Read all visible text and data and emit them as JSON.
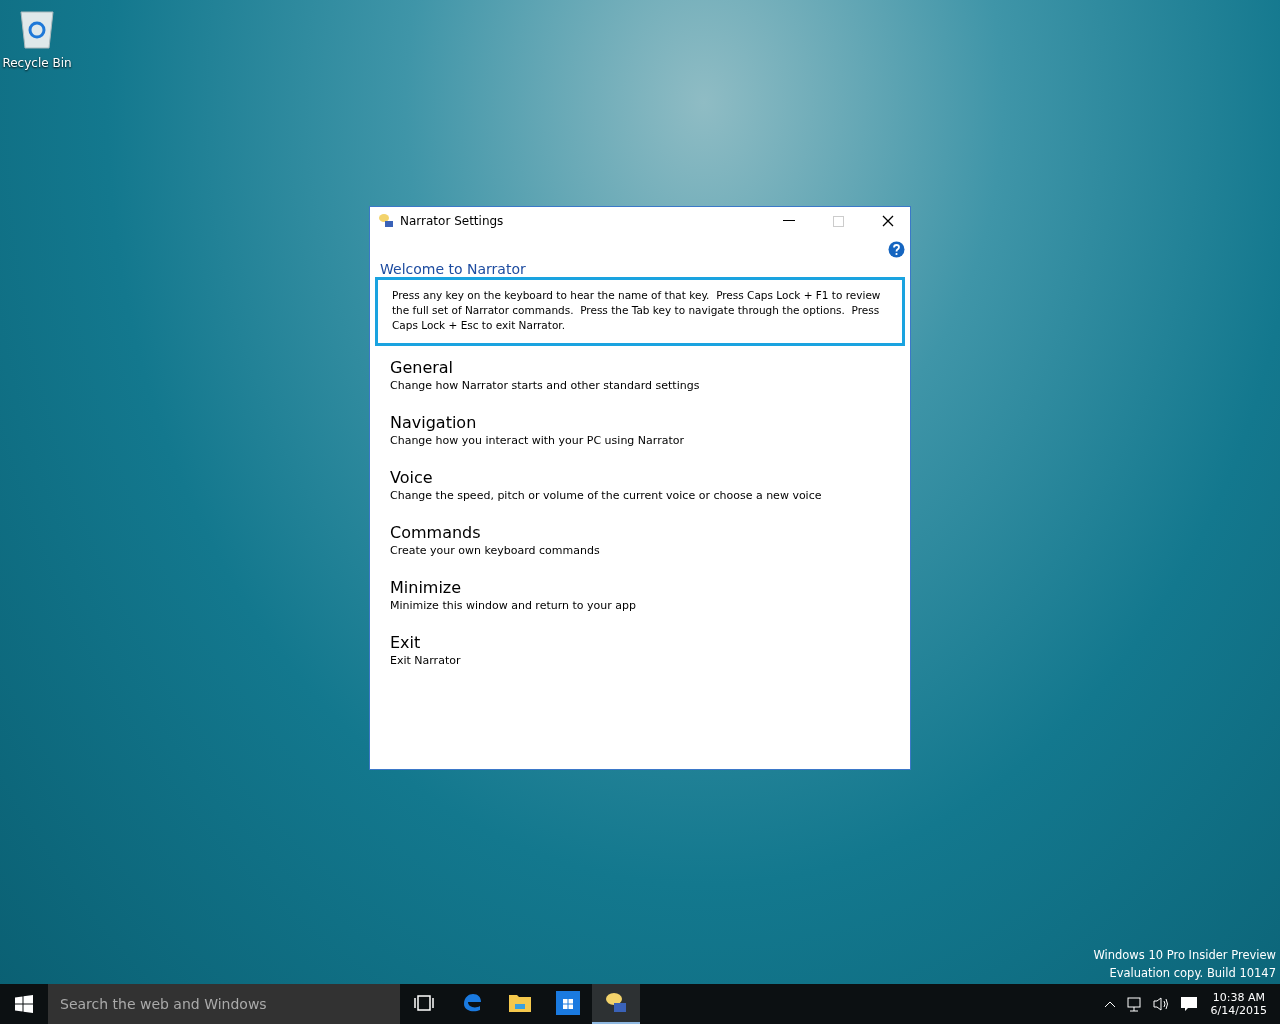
{
  "desktop_icons": [
    {
      "label": "Recycle Bin"
    }
  ],
  "window": {
    "title": "Narrator Settings",
    "heading": "Welcome to Narrator",
    "description": "Press any key on the keyboard to hear the name of that key.  Press Caps Lock + F1 to review the full set of Narrator commands.  Press the Tab key to navigate through the options.  Press Caps Lock + Esc to exit Narrator.",
    "description_focused": true,
    "options": [
      {
        "title": "General",
        "description": "Change how Narrator starts and other standard settings"
      },
      {
        "title": "Navigation",
        "description": "Change how you interact with your PC using Narrator"
      },
      {
        "title": "Voice",
        "description": "Change the speed, pitch or volume of the current voice or choose a new voice"
      },
      {
        "title": "Commands",
        "description": "Create your own keyboard commands"
      },
      {
        "title": "Minimize",
        "description": "Minimize this window and return to your app"
      },
      {
        "title": "Exit",
        "description": "Exit Narrator"
      }
    ]
  },
  "build_info": [
    "Windows 10 Pro Insider Preview",
    "Evaluation copy. Build 10147"
  ],
  "taskbar": {
    "search": {
      "placeholder": "Search the web and Windows"
    },
    "apps": [
      {
        "kind": "taskview",
        "selected": false
      },
      {
        "kind": "edge",
        "selected": false
      },
      {
        "kind": "explorer",
        "selected": false
      },
      {
        "kind": "store",
        "selected": false
      },
      {
        "kind": "narrator",
        "selected": true
      }
    ],
    "clock": {
      "time": "10:38 AM",
      "date": "6/14/2015"
    }
  }
}
